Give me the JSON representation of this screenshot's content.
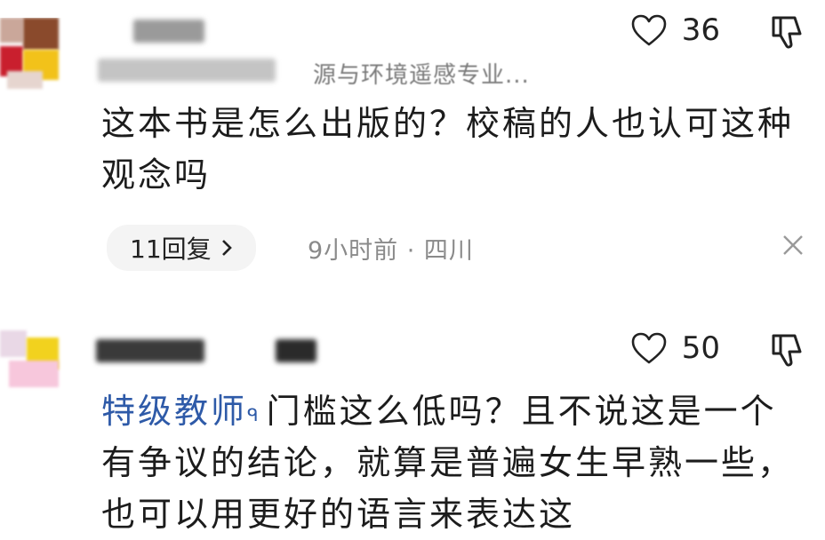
{
  "comments": [
    {
      "subtitle": "源与环境遥感专业...",
      "text": "这本书是怎么出版的？校稿的人也认可这种观念吗",
      "likes": "36",
      "replies_label": "11回复",
      "time_location": "9小时前 · 四川",
      "icons": [
        "heart-outline-icon",
        "thumbs-down-icon",
        "chevron-right-icon",
        "close-icon"
      ]
    },
    {
      "tag": "特级教师",
      "tag_symbol": "ᑫ",
      "text": "门槛这么低吗？且不说这是一个有争议的结论，就算是普遍女生早熟一些，也可以用更好的语言来表达这",
      "likes": "50",
      "icons": [
        "heart-outline-icon",
        "thumbs-down-icon"
      ]
    }
  ],
  "colors": {
    "text": "#1c1c1c",
    "muted": "#8a8a8a",
    "tag_blue": "#2e5aa8",
    "pill_bg": "#f4f4f4"
  }
}
